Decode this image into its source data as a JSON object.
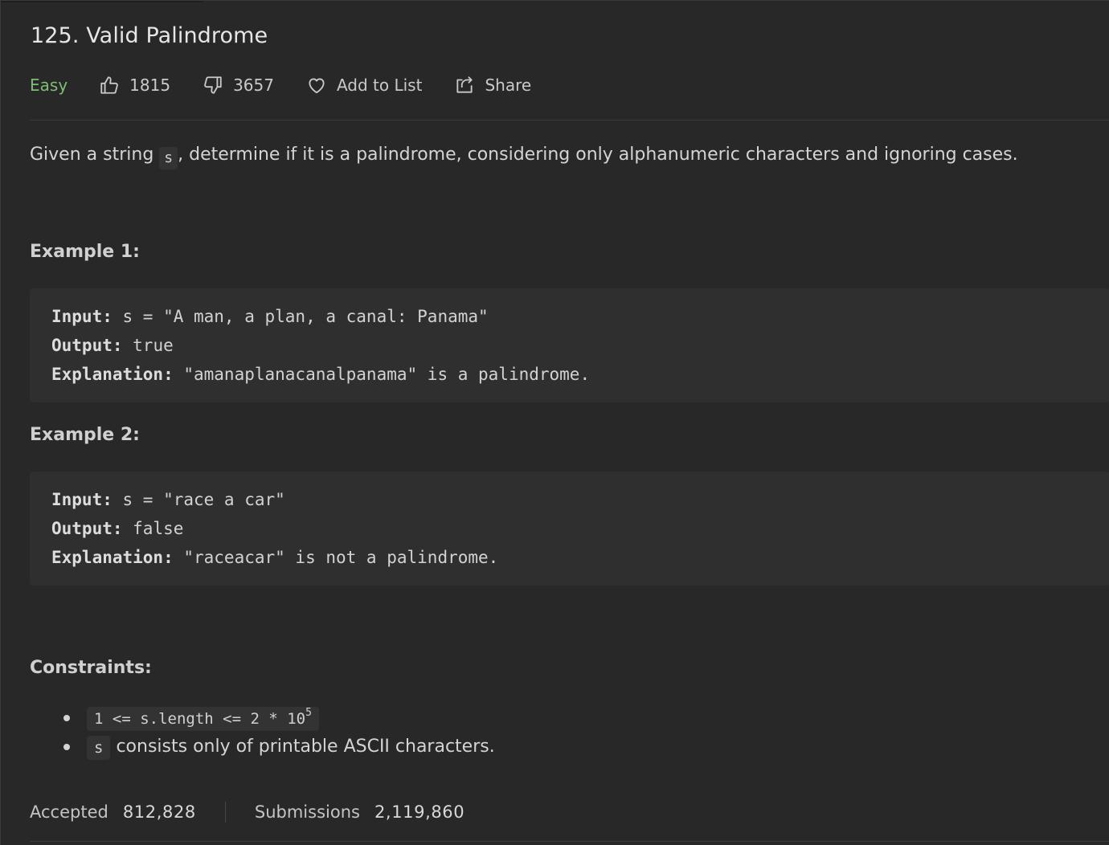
{
  "problem": {
    "title": "125. Valid Palindrome",
    "difficulty": "Easy",
    "likes": "1815",
    "dislikes": "3657",
    "add_to_list_label": "Add to List",
    "share_label": "Share"
  },
  "description": {
    "before": "Given a string ",
    "code": "s",
    "after": ", determine if it is a palindrome, considering only alphanumeric characters and ignoring cases."
  },
  "examples": [
    {
      "heading": "Example 1:",
      "input_label": "Input:",
      "input_value": " s = \"A man, a plan, a canal: Panama\"",
      "output_label": "Output:",
      "output_value": " true",
      "explanation_label": "Explanation:",
      "explanation_value": " \"amanaplanacanalpanama\" is a palindrome."
    },
    {
      "heading": "Example 2:",
      "input_label": "Input:",
      "input_value": " s = \"race a car\"",
      "output_label": "Output:",
      "output_value": " false",
      "explanation_label": "Explanation:",
      "explanation_value": " \"raceacar\" is not a palindrome."
    }
  ],
  "constraints": {
    "heading": "Constraints:",
    "items": [
      {
        "code": "1 <= s.length <= 2 * 10",
        "sup": "5",
        "text": ""
      },
      {
        "code": "s",
        "sup": "",
        "text": " consists only of printable ASCII characters."
      }
    ]
  },
  "stats": {
    "accepted_label": "Accepted",
    "accepted_value": "812,828",
    "submissions_label": "Submissions",
    "submissions_value": "2,119,860"
  },
  "colors": {
    "easy": "#7fbd74",
    "background": "#282828",
    "code_block": "#2f2f2f"
  }
}
